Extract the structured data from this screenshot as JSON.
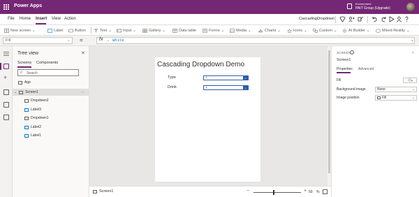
{
  "titlebar": {
    "app_name": "Power Apps",
    "environment_label": "Environment",
    "environment_name": "PAIT Group (Upgrade)"
  },
  "menu": {
    "items": [
      "File",
      "Home",
      "Insert",
      "View",
      "Action"
    ],
    "active": "Insert",
    "app_title": "CascadingDropdown"
  },
  "toolbar": {
    "items": [
      "New screen",
      "Label",
      "Button",
      "Text",
      "Input",
      "Gallery",
      "Data table",
      "Forms",
      "Media",
      "Charts",
      "Icons",
      "Custom",
      "AI Builder",
      "Mixed Reality"
    ]
  },
  "formula": {
    "property": "Fill",
    "fx_label": "fx",
    "value": "White"
  },
  "tree": {
    "title": "Tree view",
    "tabs": [
      "Screens",
      "Components"
    ],
    "search_placeholder": "Search",
    "nodes": [
      "App",
      "Screen1",
      "Dropdown2",
      "Label3",
      "Dropdown1",
      "Label2",
      "Label1"
    ]
  },
  "canvas": {
    "title": "Cascading Dropdown Demo",
    "type_label": "Type",
    "drink_label": "Drink",
    "dropdown1_value": "1",
    "dropdown2_value": "1"
  },
  "status": {
    "screen_name": "Screen1",
    "zoom_minus": "−",
    "zoom_plus": "+",
    "zoom_value": "50",
    "zoom_unit": "%"
  },
  "properties": {
    "kind": "SCREEN",
    "name": "Screen1",
    "tabs": [
      "Properties",
      "Advanced"
    ],
    "fill_label": "Fill",
    "background_image_label": "Background image",
    "background_image_value": "None",
    "image_position_label": "Image position",
    "image_position_value": "Fill"
  },
  "colors": {
    "brand": "#742774",
    "dropdown_accent": "#2f5ea8",
    "formula_text": "#0078d4"
  }
}
